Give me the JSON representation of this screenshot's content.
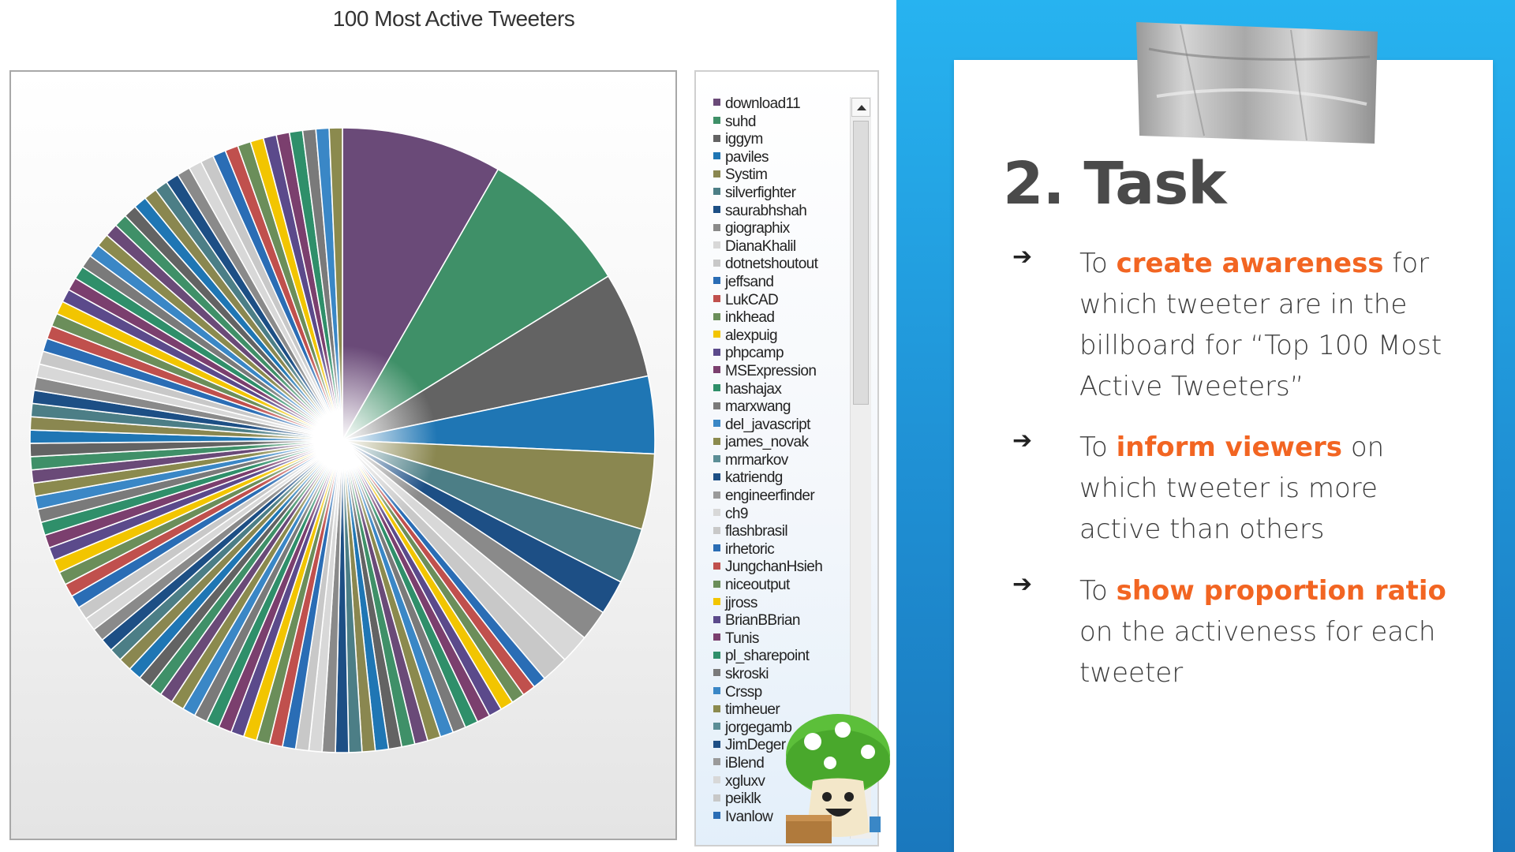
{
  "chart_data": {
    "type": "pie",
    "title": "100 Most Active Tweeters",
    "legend_placement": "right",
    "largest_slices": [
      {
        "label": "download11",
        "value": 8.3,
        "color": "#6a4a78"
      },
      {
        "label": "suhd",
        "value": 7.9,
        "color": "#3f9068"
      },
      {
        "label": "iggym",
        "value": 5.5,
        "color": "#636363"
      },
      {
        "label": "paviles",
        "value": 4.0,
        "color": "#1f76b4"
      },
      {
        "label": "Systim",
        "value": 3.9,
        "color": "#8a8750"
      },
      {
        "label": "silverfighter",
        "value": 2.9,
        "color": "#4c7e86"
      },
      {
        "label": "saurabhshah",
        "value": 1.8,
        "color": "#1d4f85"
      },
      {
        "label": "giographix",
        "value": 1.6,
        "color": "#8a8a8a"
      },
      {
        "label": "DianaKhalil",
        "value": 1.5,
        "color": "#d8d8d8"
      },
      {
        "label": "dotnetshoutout",
        "value": 1.4,
        "color": "#c8c8c8"
      }
    ],
    "small_slice_count": 90,
    "small_slice_value": 0.68,
    "palette": [
      "#6a4a78",
      "#3f9068",
      "#636363",
      "#1f76b4",
      "#8a8750",
      "#4c7e86",
      "#1d4f85",
      "#8a8a8a",
      "#d8d8d8",
      "#c8c8c8",
      "#2a6db5",
      "#c0504d",
      "#6b8e5a",
      "#f2c500",
      "#5b4a8b",
      "#7b3f6e",
      "#2f8f6a",
      "#7a7a7a",
      "#3a87c6",
      "#8b8a4e"
    ],
    "legend": [
      {
        "label": "download11",
        "color": "#6a4a78"
      },
      {
        "label": "suhd",
        "color": "#3f9068"
      },
      {
        "label": "iggym",
        "color": "#636363"
      },
      {
        "label": "paviles",
        "color": "#1f76b4"
      },
      {
        "label": "Systim",
        "color": "#8a8750"
      },
      {
        "label": "silverfighter",
        "color": "#4c7e86"
      },
      {
        "label": "saurabhshah",
        "color": "#1d4f85"
      },
      {
        "label": "giographix",
        "color": "#8a8a8a"
      },
      {
        "label": "DianaKhalil",
        "color": "#d8d8d8"
      },
      {
        "label": "dotnetshoutout",
        "color": "#c8c8c8"
      },
      {
        "label": "jeffsand",
        "color": "#2a6db5"
      },
      {
        "label": "LukCAD",
        "color": "#c0504d"
      },
      {
        "label": "inkhead",
        "color": "#6b8e5a"
      },
      {
        "label": "alexpuig",
        "color": "#f2c500"
      },
      {
        "label": "phpcamp",
        "color": "#5b4a8b"
      },
      {
        "label": "MSExpression",
        "color": "#7b3f6e"
      },
      {
        "label": "hashajax",
        "color": "#2f8f6a"
      },
      {
        "label": "marxwang",
        "color": "#7a7a7a"
      },
      {
        "label": "del_javascript",
        "color": "#3a87c6"
      },
      {
        "label": "james_novak",
        "color": "#8b8a4e"
      },
      {
        "label": "mrmarkov",
        "color": "#5b8e96"
      },
      {
        "label": "katriendg",
        "color": "#1d4f85"
      },
      {
        "label": "engineerfinder",
        "color": "#9a9a9a"
      },
      {
        "label": "ch9",
        "color": "#d8d8d8"
      },
      {
        "label": "flashbrasil",
        "color": "#c8c8c8"
      },
      {
        "label": "irhetoric",
        "color": "#2a6db5"
      },
      {
        "label": "JungchanHsieh",
        "color": "#c0504d"
      },
      {
        "label": "niceoutput",
        "color": "#6b8e5a"
      },
      {
        "label": "jjross",
        "color": "#f2c500"
      },
      {
        "label": "BrianBBrian",
        "color": "#5b4a8b"
      },
      {
        "label": "Tunis",
        "color": "#7b3f6e"
      },
      {
        "label": "pl_sharepoint",
        "color": "#2f8f6a"
      },
      {
        "label": "skroski",
        "color": "#7a7a7a"
      },
      {
        "label": "Crssp",
        "color": "#3a87c6"
      },
      {
        "label": "timheuer",
        "color": "#8b8a4e"
      },
      {
        "label": "jorgegamb",
        "color": "#5b8e96"
      },
      {
        "label": "JimDeger",
        "color": "#1d4f85"
      },
      {
        "label": "iBlend",
        "color": "#9a9a9a"
      },
      {
        "label": "xgluxv",
        "color": "#d8d8d8"
      },
      {
        "label": "peiklk",
        "color": "#c8c8c8"
      },
      {
        "label": "Ivanlow",
        "color": "#2a6db5"
      }
    ]
  },
  "slide": {
    "heading": "2. Task",
    "arrow_glyph": "➔",
    "bullets": [
      {
        "pre": "To ",
        "highlight": "create awareness",
        "post": " for which tweeter are in the billboard for “Top 100 Most Active Tweeters”"
      },
      {
        "pre": "To ",
        "highlight": "inform viewers",
        "post": " on which tweeter is more active than others"
      },
      {
        "pre": "To ",
        "highlight": "show proportion ratio",
        "post": " on the activeness for each tweeter"
      }
    ],
    "accent_color": "#f26522",
    "background_color": "#1f90d4"
  }
}
